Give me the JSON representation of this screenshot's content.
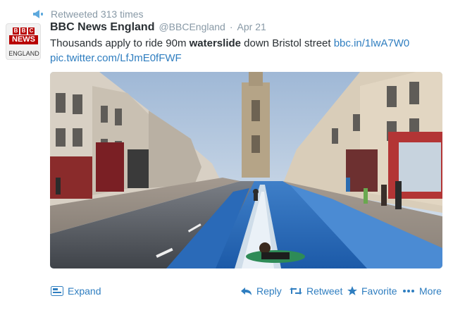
{
  "retweet": {
    "text": "Retweeted 313 times"
  },
  "avatar": {
    "letters": [
      "B",
      "B",
      "C"
    ],
    "wordmark": "NEWS",
    "region": "ENGLAND"
  },
  "author": {
    "fullname": "BBC News England",
    "username": "@BBCEngland",
    "separator": "·",
    "time": "Apr 21"
  },
  "tweet": {
    "text_before": "Thousands apply to ride 90m ",
    "text_bold": "waterslide",
    "text_after": " down Bristol street ",
    "link_1": "bbc.in/1lwA7W0",
    "link_2": "pic.twitter.com/LfJmE0fFWF"
  },
  "actions": {
    "expand": "Expand",
    "reply": "Reply",
    "retweet": "Retweet",
    "favorite": "Favorite",
    "more": "More"
  },
  "colors": {
    "link": "#2f7ec0",
    "muted": "#8899a6",
    "bbc_red": "#b80000"
  }
}
